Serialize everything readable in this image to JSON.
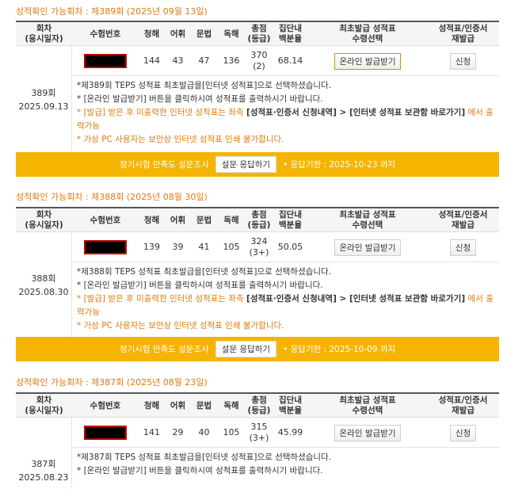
{
  "headers": [
    "회차\n(응시일자)",
    "수험번호",
    "청해",
    "어휘",
    "문법",
    "독해",
    "총점\n(등급)",
    "집단내\n백분율",
    "최초발급 성적표\n수령선택",
    "성적표/인증서\n재발급"
  ],
  "sections": [
    {
      "title": "성적확인 가능회차 : 제389회 (2025년 09월 13일)",
      "round": "389회",
      "date": "2025.09.13",
      "listening": "144",
      "vocab": "43",
      "grammar": "47",
      "reading": "136",
      "total": "370\n(2)",
      "percentile": "68.14",
      "issue_btn": "온라인 발급받기",
      "reissue_btn": "신청",
      "notes": [
        "*제389회 TEPS 성적표 최초발급을[인터넷 성적표]으로 선택하셨습니다.",
        "* [온라인 발급받기] 버튼을 클릭하시여 성적표를 출력하시기 바랍니다.",
        "* [발급] 받은 후 미출력한 인터넷 성적표는 좌측",
        "[성적표·인증서 신청내역] > [인터넷 성적표 보관함 바로가기]",
        " 에서 출력가능",
        "* 가상 PC 사용자는 보안상 인터넷 성적표 인쇄 불가합니다."
      ],
      "survey_label": "정기시험 만족도 설문조사",
      "survey_btn": "설문 응답하기",
      "survey_deadline": "• 응답기한 : 2025-10-23 까지"
    },
    {
      "title": "성적확인 가능회차 : 제388회 (2025년 08월 30일)",
      "round": "388회",
      "date": "2025.08.30",
      "listening": "139",
      "vocab": "39",
      "grammar": "41",
      "reading": "105",
      "total": "324\n(3+)",
      "percentile": "50.05",
      "issue_btn": "온라인 발급받기",
      "reissue_btn": "신청",
      "notes": [
        "*제388회 TEPS 성적표 최초발급을[인터넷 성적표]으로 선택하셨습니다.",
        "* [온라인 발급받기] 버튼을 클릭하시여 성적표를 출력하시기 바랍니다.",
        "* [발급] 받은 후 미출력한 인터넷 성적표는 좌측",
        "[성적표·인증서 신청내역] > [인터넷 성적표 보관함 바로가기]",
        " 에서 출력가능",
        "* 가상 PC 사용자는 보안상 인터넷 성적표 인쇄 불가합니다."
      ],
      "survey_label": "정기시험 만족도 설문조사",
      "survey_btn": "설문 응답하기",
      "survey_deadline": "• 응답기한 : 2025-10-09 까지"
    },
    {
      "title": "성적확인 가능회차 : 제387회 (2025년 08월 23일)",
      "round": "387회",
      "date": "2025.08.23",
      "listening": "141",
      "vocab": "29",
      "grammar": "40",
      "reading": "105",
      "total": "315\n(3+)",
      "percentile": "45.99",
      "issue_btn": "온라인 발급받기",
      "reissue_btn": "신청",
      "notes": [
        "*제387회 TEPS 성적표 최초발급을[인터넷 성적표]으로 선택하셨습니다.",
        "* [온라인 발급받기] 버튼을 클릭하시여 성적표를 출력하시기 바랍니다."
      ]
    }
  ]
}
